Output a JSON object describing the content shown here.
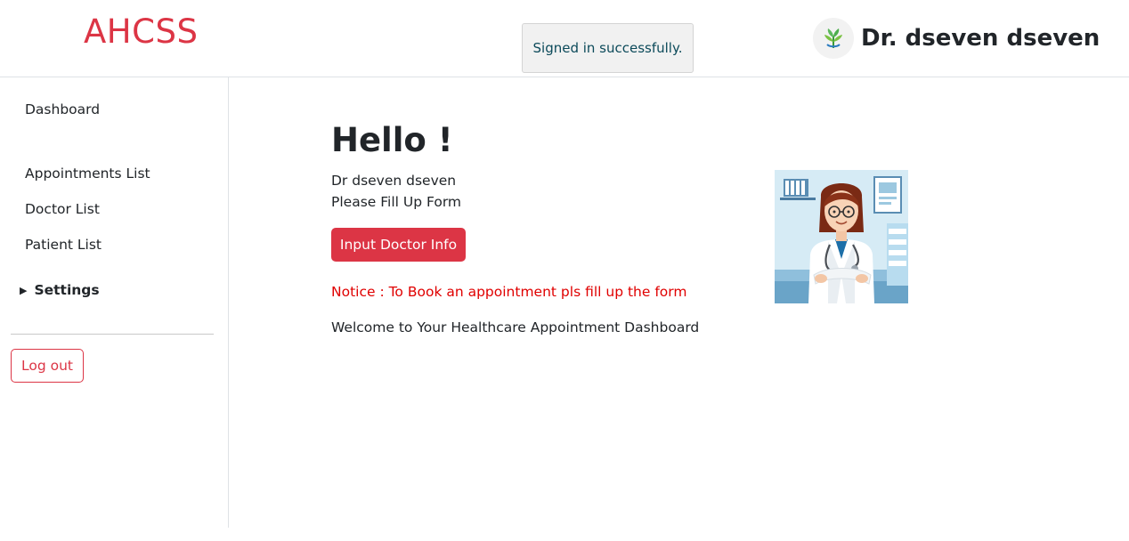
{
  "header": {
    "brand": "AHCSS",
    "toast": "Signed in successfully.",
    "user_name": "Dr. dseven dseven",
    "avatar_icon": "plant-logo-icon"
  },
  "sidebar": {
    "items": [
      {
        "label": "Dashboard"
      },
      {
        "label": "Appointments List"
      },
      {
        "label": "Doctor List"
      },
      {
        "label": "Patient List"
      }
    ],
    "settings_label": "Settings",
    "logout_label": "Log out"
  },
  "main": {
    "greeting": "Hello !",
    "doctor_name": "Dr dseven dseven",
    "instruction": "Please Fill Up Form",
    "input_button": "Input Doctor Info",
    "notice": "Notice : To Book an appointment pls fill up the form",
    "welcome": "Welcome to Your Healthcare Appointment Dashboard",
    "illustration_icon": "doctor-illustration"
  },
  "colors": {
    "accent": "#dc3545",
    "notice": "#e00000",
    "toast_text": "#0c4a5a"
  }
}
